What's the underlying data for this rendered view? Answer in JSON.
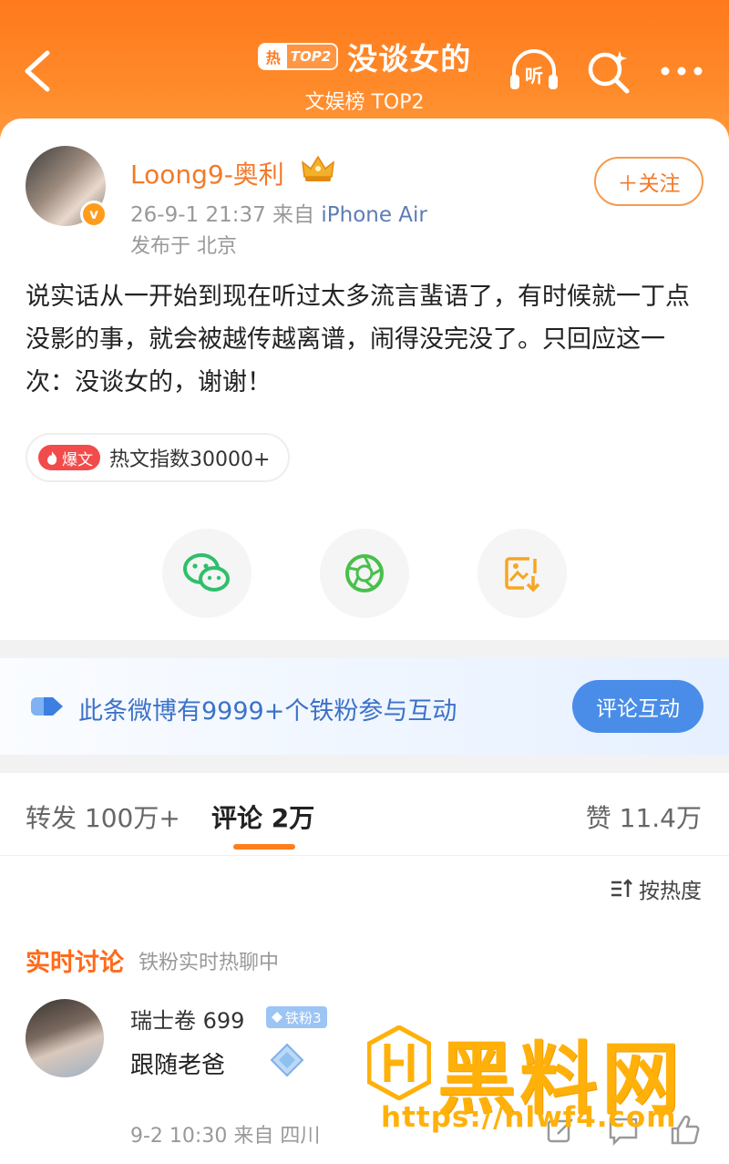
{
  "header": {
    "hot_char": "热",
    "rank_badge": "TOP2",
    "title": "没谈女的",
    "subtitle": "文娱榜 TOP2"
  },
  "post": {
    "username": "Loong9-奥利",
    "verified_badge": "v",
    "time": "26-9-1 21:37",
    "source_prefix": "来自",
    "device": "iPhone Air",
    "location": "发布于 北京",
    "follow_label": "＋关注",
    "text": "说实话从一开始到现在听过太多流言蜚语了，有时候就一丁点没影的事，就会被越传越离谱，闹得没完没了。只回应这一次：没谈女的，谢谢！",
    "hot_tag_badge": "爆文",
    "hot_tag_text": "热文指数30000+"
  },
  "share": {
    "items": [
      "wechat-icon",
      "moments-icon",
      "save-image-icon"
    ]
  },
  "banner": {
    "text": "此条微博有9999+个铁粉参与互动",
    "button": "评论互动"
  },
  "tabs": {
    "repost": "转发 100万+",
    "comment": "评论 2万",
    "like": "赞 11.4万"
  },
  "sort_label": "按热度",
  "realtime": {
    "title": "实时讨论",
    "subtitle": "铁粉实时热聊中"
  },
  "comment": {
    "name": "瑞士卷 699",
    "badge": "铁粉3",
    "text": "跟随老爸",
    "meta": "9-2 10:30  来自 四川"
  },
  "watermark": {
    "title": "黑料网",
    "url": "https://hlwf4.com"
  },
  "colors": {
    "brand_orange": "#ff7a1c",
    "link_blue": "#3c72c8",
    "watermark": "#ffb10a"
  }
}
